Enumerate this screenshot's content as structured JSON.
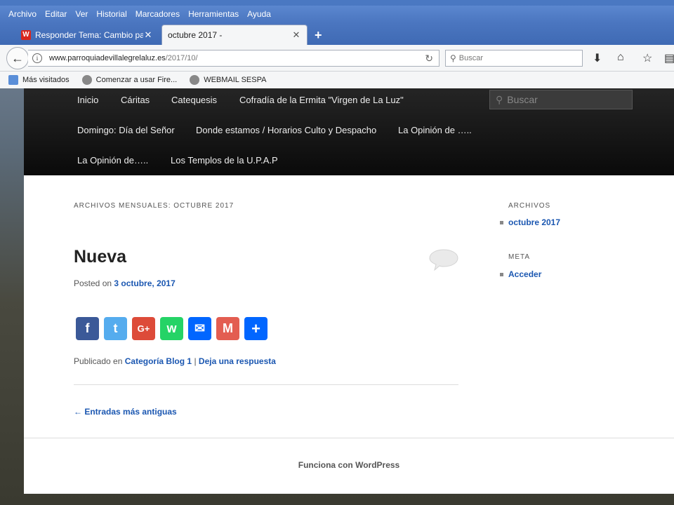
{
  "menubar": {
    "items": [
      "Archivo",
      "Editar",
      "Ver",
      "Historial",
      "Marcadores",
      "Herramientas",
      "Ayuda"
    ]
  },
  "tabs": [
    {
      "title": "Responder Tema: Cambio pa...",
      "favicon": "W"
    },
    {
      "title": "octubre 2017 -"
    }
  ],
  "navbar": {
    "url_host": "www.parroquiadevillalegrelaluz.es",
    "url_path": "/2017/10/",
    "search_placeholder": "Buscar"
  },
  "bookmarks": [
    "Más visitados",
    "Comenzar a usar Fire...",
    "WEBMAIL SESPA"
  ],
  "site": {
    "nav_row1": [
      "Inicio",
      "Cáritas",
      "Catequesis",
      "Cofradía de la Ermita \"Virgen de La Luz\""
    ],
    "nav_row2": [
      "Domingo: Día del Señor",
      "Donde estamos / Horarios Culto y Despacho",
      "La Opinión de ….."
    ],
    "nav_row3": [
      "La Opinión de…..",
      "Los Templos de la U.P.A.P"
    ],
    "search_placeholder": "Buscar",
    "archive_title": "ARCHIVOS MENSUALES: OCTUBRE 2017",
    "post_title": "Nueva",
    "posted_prefix": "Posted on",
    "posted_date": "3 octubre, 2017",
    "share": [
      {
        "label": "f",
        "color": "#3b5998"
      },
      {
        "label": "t",
        "color": "#55acee"
      },
      {
        "label": "G+",
        "color": "#dd4b39"
      },
      {
        "label": "w",
        "color": "#25d366"
      },
      {
        "label": "✉",
        "color": "#0166ff"
      },
      {
        "label": "M",
        "color": "#e35d51"
      },
      {
        "label": "+",
        "color": "#0166ff"
      }
    ],
    "meta_prefix": "Publicado en",
    "meta_category": "Categoría Blog 1",
    "meta_separator": "|",
    "meta_reply": "Deja una respuesta",
    "older_link": "← Entradas más antiguas",
    "sidebar": {
      "archives_title": "ARCHIVOS",
      "archives_item": "octubre 2017",
      "meta_title": "META",
      "meta_item": "Acceder"
    },
    "footer": "Funciona con WordPress"
  }
}
